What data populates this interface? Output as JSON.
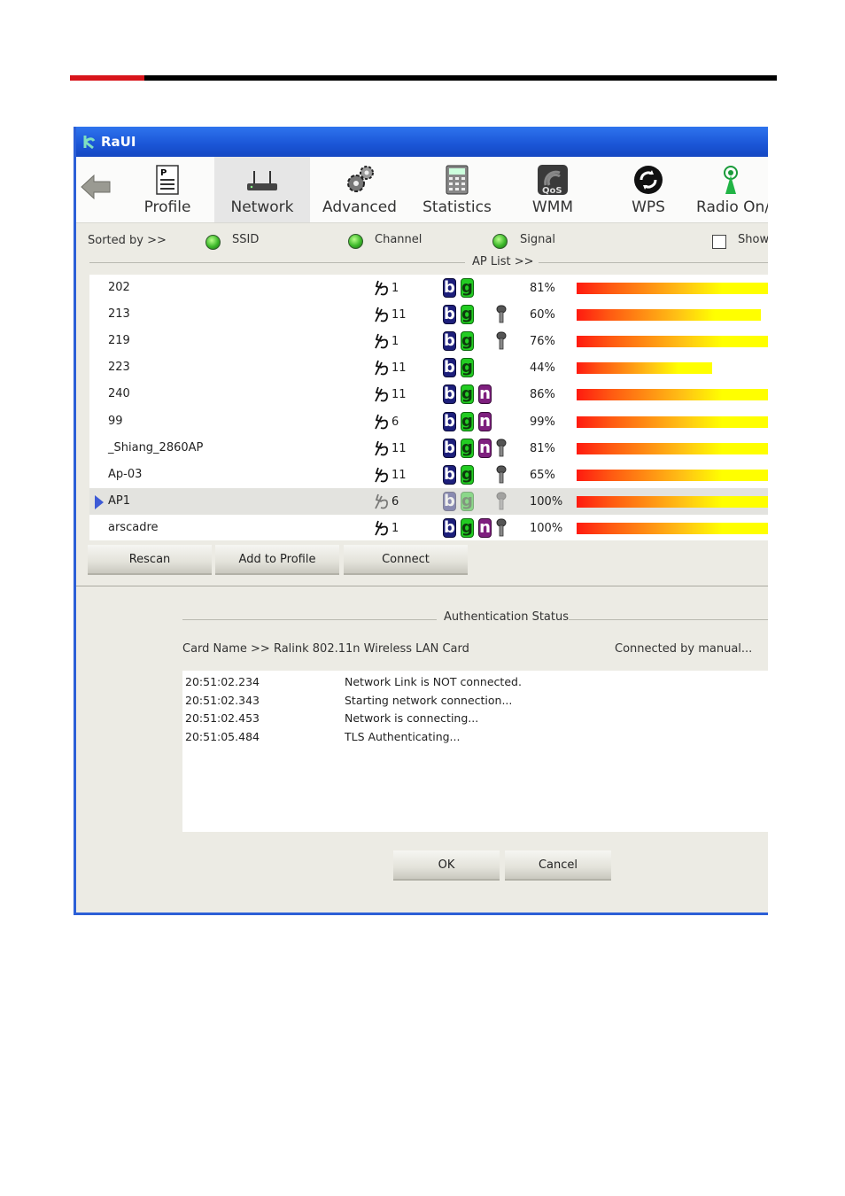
{
  "window": {
    "title": "RaUI"
  },
  "toolbar": {
    "items": [
      {
        "label": "Profile",
        "icon": "profile-icon"
      },
      {
        "label": "Network",
        "icon": "network-router-icon",
        "active": true
      },
      {
        "label": "Advanced",
        "icon": "gears-icon"
      },
      {
        "label": "Statistics",
        "icon": "calculator-icon"
      },
      {
        "label": "WMM",
        "icon": "qos-icon"
      },
      {
        "label": "WPS",
        "icon": "wps-icon"
      },
      {
        "label": "Radio On/",
        "icon": "radio-antenna-icon"
      }
    ]
  },
  "sort": {
    "label": "Sorted by >>",
    "options": [
      "SSID",
      "Channel",
      "Signal"
    ],
    "show_label": "Show",
    "ap_list_label": "AP List >>"
  },
  "ap_list": [
    {
      "ssid": "202",
      "channel": "1",
      "modes": [
        "b",
        "g"
      ],
      "secured": false,
      "signal": "81%",
      "signal_pct": 100
    },
    {
      "ssid": "213",
      "channel": "11",
      "modes": [
        "b",
        "g"
      ],
      "secured": true,
      "signal": "60%",
      "signal_pct": 95
    },
    {
      "ssid": "219",
      "channel": "1",
      "modes": [
        "b",
        "g"
      ],
      "secured": true,
      "signal": "76%",
      "signal_pct": 100
    },
    {
      "ssid": "223",
      "channel": "11",
      "modes": [
        "b",
        "g"
      ],
      "secured": false,
      "signal": "44%",
      "signal_pct": 70
    },
    {
      "ssid": "240",
      "channel": "11",
      "modes": [
        "b",
        "g",
        "n"
      ],
      "secured": false,
      "signal": "86%",
      "signal_pct": 100
    },
    {
      "ssid": "99",
      "channel": "6",
      "modes": [
        "b",
        "g",
        "n"
      ],
      "secured": false,
      "signal": "99%",
      "signal_pct": 100
    },
    {
      "ssid": "_Shiang_2860AP",
      "channel": "11",
      "modes": [
        "b",
        "g",
        "n"
      ],
      "secured": true,
      "signal": "81%",
      "signal_pct": 100
    },
    {
      "ssid": "Ap-03",
      "channel": "11",
      "modes": [
        "b",
        "g"
      ],
      "secured": true,
      "signal": "65%",
      "signal_pct": 100
    },
    {
      "ssid": "AP1",
      "channel": "6",
      "modes": [
        "b",
        "g"
      ],
      "secured": true,
      "signal": "100%",
      "signal_pct": 100,
      "selected": true
    },
    {
      "ssid": "arscadre",
      "channel": "1",
      "modes": [
        "b",
        "g",
        "n"
      ],
      "secured": true,
      "signal": "100%",
      "signal_pct": 100
    }
  ],
  "buttons": {
    "rescan": "Rescan",
    "add_to_profile": "Add to Profile",
    "connect": "Connect",
    "ok": "OK",
    "cancel": "Cancel"
  },
  "auth": {
    "title": "Authentication Status",
    "card_name": "Card Name >> Ralink 802.11n Wireless LAN Card",
    "connected_by": "Connected by manual...",
    "log": [
      {
        "time": "20:51:02.234",
        "msg": "Network Link is NOT connected."
      },
      {
        "time": "20:51:02.343",
        "msg": "Starting network connection..."
      },
      {
        "time": "20:51:02.453",
        "msg": "Network is connecting..."
      },
      {
        "time": "20:51:05.484",
        "msg": "TLS Authenticating..."
      }
    ]
  }
}
